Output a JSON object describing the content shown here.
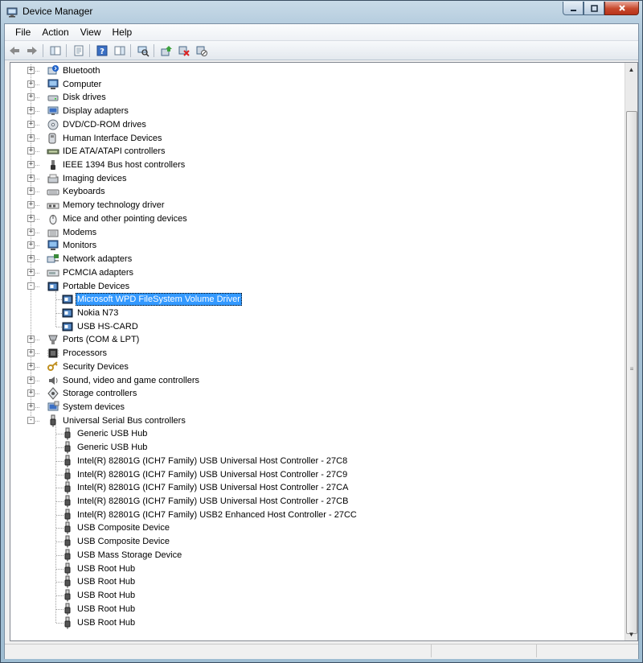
{
  "window": {
    "title": "Device Manager"
  },
  "menu": [
    "File",
    "Action",
    "View",
    "Help"
  ],
  "toolbar": [
    {
      "name": "back-icon"
    },
    {
      "name": "forward-icon"
    },
    {
      "sep": true
    },
    {
      "name": "show-hide-console-tree-icon"
    },
    {
      "sep": true
    },
    {
      "name": "properties-icon"
    },
    {
      "sep": true
    },
    {
      "name": "help-icon"
    },
    {
      "name": "show-hide-action-pane-icon"
    },
    {
      "sep": true
    },
    {
      "name": "scan-hardware-changes-icon"
    },
    {
      "sep": true
    },
    {
      "name": "update-driver-icon"
    },
    {
      "name": "uninstall-icon"
    },
    {
      "name": "disable-icon"
    }
  ],
  "tree": [
    {
      "label": "Bluetooth",
      "level": 0,
      "exp": "+",
      "icon": "bluetooth"
    },
    {
      "label": "Computer",
      "level": 0,
      "exp": "+",
      "icon": "computer"
    },
    {
      "label": "Disk drives",
      "level": 0,
      "exp": "+",
      "icon": "disk"
    },
    {
      "label": "Display adapters",
      "level": 0,
      "exp": "+",
      "icon": "display"
    },
    {
      "label": "DVD/CD-ROM drives",
      "level": 0,
      "exp": "+",
      "icon": "dvd"
    },
    {
      "label": "Human Interface Devices",
      "level": 0,
      "exp": "+",
      "icon": "hid"
    },
    {
      "label": "IDE ATA/ATAPI controllers",
      "level": 0,
      "exp": "+",
      "icon": "ide"
    },
    {
      "label": "IEEE 1394 Bus host controllers",
      "level": 0,
      "exp": "+",
      "icon": "ieee"
    },
    {
      "label": "Imaging devices",
      "level": 0,
      "exp": "+",
      "icon": "imaging"
    },
    {
      "label": "Keyboards",
      "level": 0,
      "exp": "+",
      "icon": "keyboard"
    },
    {
      "label": "Memory technology driver",
      "level": 0,
      "exp": "+",
      "icon": "memory"
    },
    {
      "label": "Mice and other pointing devices",
      "level": 0,
      "exp": "+",
      "icon": "mouse"
    },
    {
      "label": "Modems",
      "level": 0,
      "exp": "+",
      "icon": "modem"
    },
    {
      "label": "Monitors",
      "level": 0,
      "exp": "+",
      "icon": "monitor"
    },
    {
      "label": "Network adapters",
      "level": 0,
      "exp": "+",
      "icon": "network"
    },
    {
      "label": "PCMCIA adapters",
      "level": 0,
      "exp": "+",
      "icon": "pcmcia"
    },
    {
      "label": "Portable Devices",
      "level": 0,
      "exp": "-",
      "icon": "portable"
    },
    {
      "label": "Microsoft WPD FileSystem Volume Driver",
      "level": 1,
      "icon": "portable",
      "selected": true
    },
    {
      "label": "Nokia N73",
      "level": 1,
      "icon": "portable"
    },
    {
      "label": "USB  HS-CARD",
      "level": 1,
      "icon": "portable"
    },
    {
      "label": "Ports (COM & LPT)",
      "level": 0,
      "exp": "+",
      "icon": "ports"
    },
    {
      "label": "Processors",
      "level": 0,
      "exp": "+",
      "icon": "processor"
    },
    {
      "label": "Security Devices",
      "level": 0,
      "exp": "+",
      "icon": "security"
    },
    {
      "label": "Sound, video and game controllers",
      "level": 0,
      "exp": "+",
      "icon": "sound"
    },
    {
      "label": "Storage controllers",
      "level": 0,
      "exp": "+",
      "icon": "storage"
    },
    {
      "label": "System devices",
      "level": 0,
      "exp": "+",
      "icon": "system"
    },
    {
      "label": "Universal Serial Bus controllers",
      "level": 0,
      "exp": "-",
      "icon": "usb"
    },
    {
      "label": "Generic USB Hub",
      "level": 1,
      "icon": "usb"
    },
    {
      "label": "Generic USB Hub",
      "level": 1,
      "icon": "usb"
    },
    {
      "label": "Intel(R) 82801G (ICH7 Family) USB Universal Host Controller - 27C8",
      "level": 1,
      "icon": "usb"
    },
    {
      "label": "Intel(R) 82801G (ICH7 Family) USB Universal Host Controller - 27C9",
      "level": 1,
      "icon": "usb"
    },
    {
      "label": "Intel(R) 82801G (ICH7 Family) USB Universal Host Controller - 27CA",
      "level": 1,
      "icon": "usb"
    },
    {
      "label": "Intel(R) 82801G (ICH7 Family) USB Universal Host Controller - 27CB",
      "level": 1,
      "icon": "usb"
    },
    {
      "label": "Intel(R) 82801G (ICH7 Family) USB2 Enhanced Host Controller - 27CC",
      "level": 1,
      "icon": "usb"
    },
    {
      "label": "USB Composite Device",
      "level": 1,
      "icon": "usb"
    },
    {
      "label": "USB Composite Device",
      "level": 1,
      "icon": "usb"
    },
    {
      "label": "USB Mass Storage Device",
      "level": 1,
      "icon": "usb"
    },
    {
      "label": "USB Root Hub",
      "level": 1,
      "icon": "usb"
    },
    {
      "label": "USB Root Hub",
      "level": 1,
      "icon": "usb"
    },
    {
      "label": "USB Root Hub",
      "level": 1,
      "icon": "usb"
    },
    {
      "label": "USB Root Hub",
      "level": 1,
      "icon": "usb"
    },
    {
      "label": "USB Root Hub",
      "level": 1,
      "icon": "usb"
    }
  ],
  "colors": {
    "selection": "#3399ff",
    "close": "#c7482b"
  }
}
